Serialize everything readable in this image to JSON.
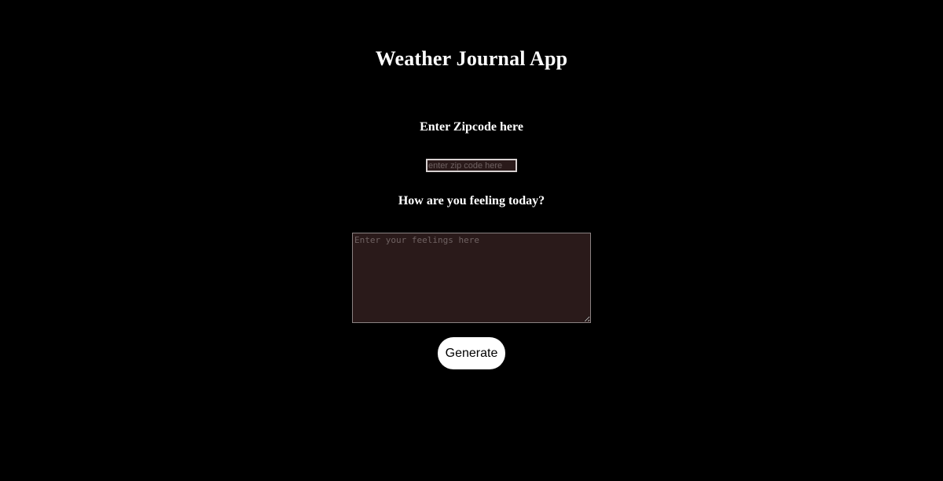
{
  "page": {
    "title": "Weather Journal App"
  },
  "zip": {
    "label": "Enter Zipcode here",
    "value": "",
    "placeholder": "enter zip code here"
  },
  "feelings": {
    "label": "How are you feeling today?",
    "value": "",
    "placeholder": "Enter your feelings here"
  },
  "actions": {
    "generate_label": "Generate"
  },
  "colors": {
    "background": "#000000",
    "text": "#ffffff",
    "input_background": "#2a1a1a",
    "button_background": "#ffffff"
  }
}
